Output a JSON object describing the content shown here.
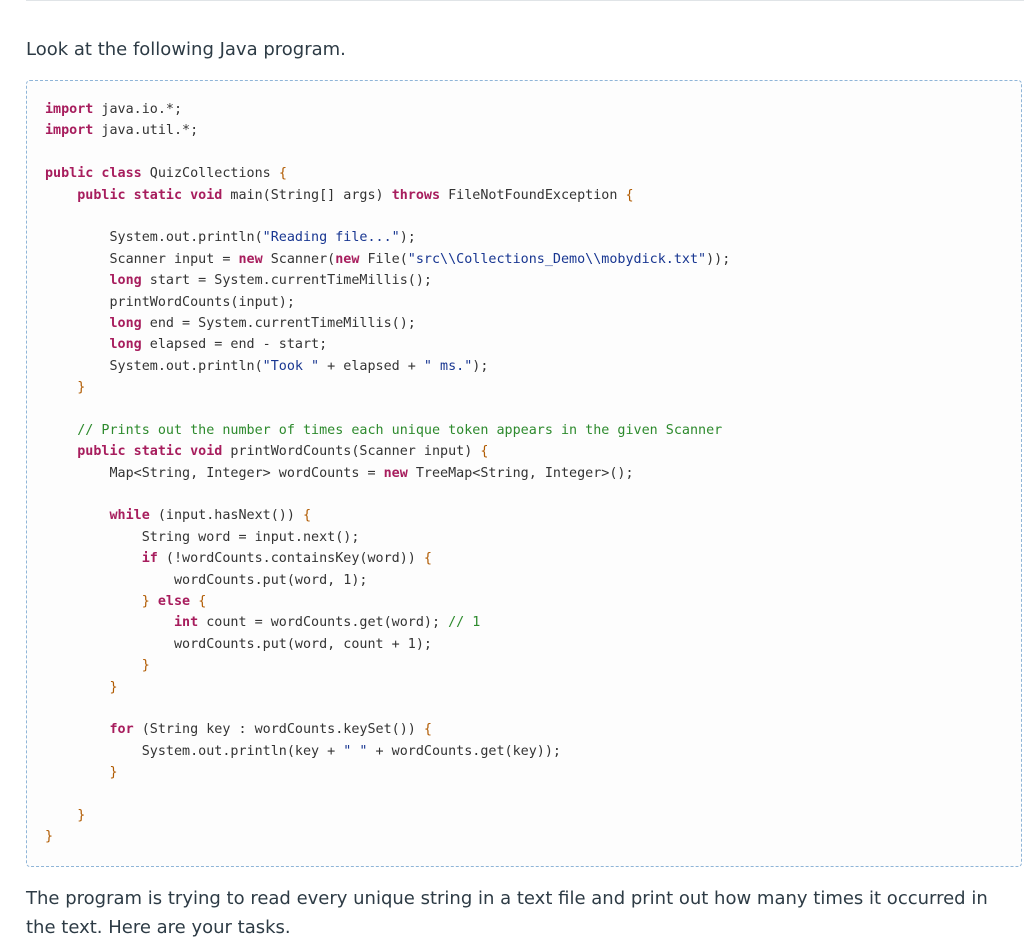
{
  "intro_text": "Look at the following Java program.",
  "code_lines": [
    [
      {
        "t": "import",
        "c": "kw"
      },
      {
        "t": " java.io.*;",
        "c": "plain"
      }
    ],
    [
      {
        "t": "import",
        "c": "kw"
      },
      {
        "t": " java.util.*;",
        "c": "plain"
      }
    ],
    [],
    [
      {
        "t": "public class",
        "c": "kw"
      },
      {
        "t": " QuizCollections ",
        "c": "plain"
      },
      {
        "t": "{",
        "c": "brace"
      }
    ],
    [
      {
        "t": "    ",
        "c": "plain"
      },
      {
        "t": "public static void",
        "c": "kw"
      },
      {
        "t": " main(String[] args) ",
        "c": "plain"
      },
      {
        "t": "throws",
        "c": "kw"
      },
      {
        "t": " FileNotFoundException ",
        "c": "plain"
      },
      {
        "t": "{",
        "c": "brace"
      }
    ],
    [],
    [
      {
        "t": "        System.out.println(",
        "c": "plain"
      },
      {
        "t": "\"Reading file...\"",
        "c": "str"
      },
      {
        "t": ");",
        "c": "plain"
      }
    ],
    [
      {
        "t": "        Scanner input = ",
        "c": "plain"
      },
      {
        "t": "new",
        "c": "kw"
      },
      {
        "t": " Scanner(",
        "c": "plain"
      },
      {
        "t": "new",
        "c": "kw"
      },
      {
        "t": " File(",
        "c": "plain"
      },
      {
        "t": "\"src\\\\Collections_Demo\\\\mobydick.txt\"",
        "c": "str"
      },
      {
        "t": "));",
        "c": "plain"
      }
    ],
    [
      {
        "t": "        ",
        "c": "plain"
      },
      {
        "t": "long",
        "c": "kw"
      },
      {
        "t": " start = System.currentTimeMillis();",
        "c": "plain"
      }
    ],
    [
      {
        "t": "        printWordCounts(input);",
        "c": "plain"
      }
    ],
    [
      {
        "t": "        ",
        "c": "plain"
      },
      {
        "t": "long",
        "c": "kw"
      },
      {
        "t": " end = System.currentTimeMillis();",
        "c": "plain"
      }
    ],
    [
      {
        "t": "        ",
        "c": "plain"
      },
      {
        "t": "long",
        "c": "kw"
      },
      {
        "t": " elapsed = end - start;",
        "c": "plain"
      }
    ],
    [
      {
        "t": "        System.out.println(",
        "c": "plain"
      },
      {
        "t": "\"Took \"",
        "c": "str"
      },
      {
        "t": " + elapsed + ",
        "c": "plain"
      },
      {
        "t": "\" ms.\"",
        "c": "str"
      },
      {
        "t": ");",
        "c": "plain"
      }
    ],
    [
      {
        "t": "    ",
        "c": "plain"
      },
      {
        "t": "}",
        "c": "brace"
      }
    ],
    [],
    [
      {
        "t": "    ",
        "c": "plain"
      },
      {
        "t": "// Prints out the number of times each unique token appears in the given Scanner",
        "c": "com"
      }
    ],
    [
      {
        "t": "    ",
        "c": "plain"
      },
      {
        "t": "public static void",
        "c": "kw"
      },
      {
        "t": " printWordCounts(Scanner input) ",
        "c": "plain"
      },
      {
        "t": "{",
        "c": "brace"
      }
    ],
    [
      {
        "t": "        Map<String, Integer> wordCounts = ",
        "c": "plain"
      },
      {
        "t": "new",
        "c": "kw"
      },
      {
        "t": " TreeMap<String, Integer>();",
        "c": "plain"
      }
    ],
    [],
    [
      {
        "t": "        ",
        "c": "plain"
      },
      {
        "t": "while",
        "c": "kw"
      },
      {
        "t": " (input.hasNext()) ",
        "c": "plain"
      },
      {
        "t": "{",
        "c": "brace"
      }
    ],
    [
      {
        "t": "            String word = input.next();",
        "c": "plain"
      }
    ],
    [
      {
        "t": "            ",
        "c": "plain"
      },
      {
        "t": "if",
        "c": "kw"
      },
      {
        "t": " (!wordCounts.containsKey(word)) ",
        "c": "plain"
      },
      {
        "t": "{",
        "c": "brace"
      }
    ],
    [
      {
        "t": "                wordCounts.put(word, 1);",
        "c": "plain"
      }
    ],
    [
      {
        "t": "            ",
        "c": "plain"
      },
      {
        "t": "}",
        "c": "brace"
      },
      {
        "t": " ",
        "c": "plain"
      },
      {
        "t": "else",
        "c": "kw"
      },
      {
        "t": " ",
        "c": "plain"
      },
      {
        "t": "{",
        "c": "brace"
      }
    ],
    [
      {
        "t": "                ",
        "c": "plain"
      },
      {
        "t": "int",
        "c": "kw"
      },
      {
        "t": " count = wordCounts.get(word); ",
        "c": "plain"
      },
      {
        "t": "// 1",
        "c": "com"
      }
    ],
    [
      {
        "t": "                wordCounts.put(word, count + 1);",
        "c": "plain"
      }
    ],
    [
      {
        "t": "            ",
        "c": "plain"
      },
      {
        "t": "}",
        "c": "brace"
      }
    ],
    [
      {
        "t": "        ",
        "c": "plain"
      },
      {
        "t": "}",
        "c": "brace"
      }
    ],
    [],
    [
      {
        "t": "        ",
        "c": "plain"
      },
      {
        "t": "for",
        "c": "kw"
      },
      {
        "t": " (String key : wordCounts.keySet()) ",
        "c": "plain"
      },
      {
        "t": "{",
        "c": "brace"
      }
    ],
    [
      {
        "t": "            System.out.println(key + ",
        "c": "plain"
      },
      {
        "t": "\" \"",
        "c": "str"
      },
      {
        "t": " + wordCounts.get(key));",
        "c": "plain"
      }
    ],
    [
      {
        "t": "        ",
        "c": "plain"
      },
      {
        "t": "}",
        "c": "brace"
      }
    ],
    [],
    [
      {
        "t": "    ",
        "c": "plain"
      },
      {
        "t": "}",
        "c": "brace"
      }
    ],
    [
      {
        "t": "}",
        "c": "brace"
      }
    ]
  ],
  "outro_text": "The program is trying to read every unique string in a text file and print out how many times it occurred in the text. Here are your tasks."
}
